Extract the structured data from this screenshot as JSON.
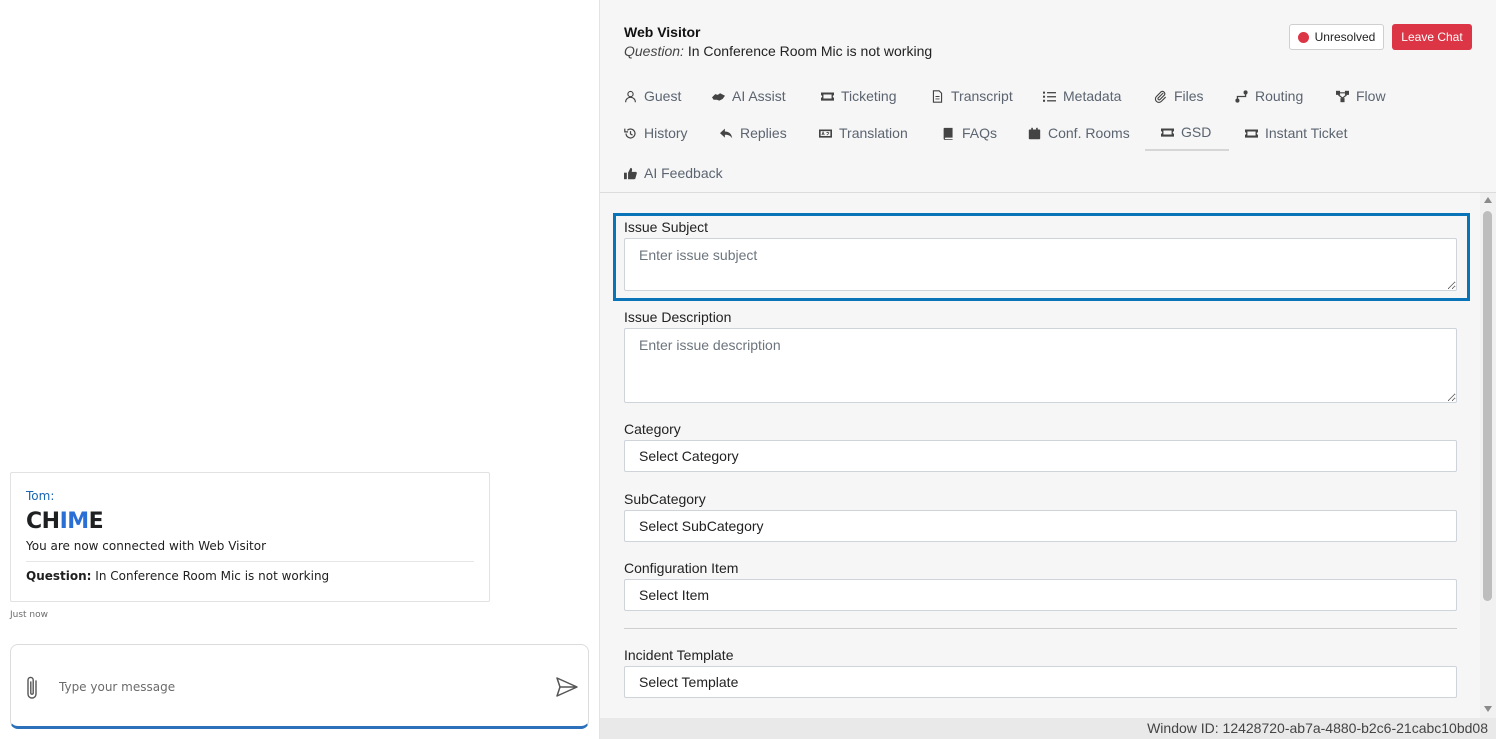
{
  "chat": {
    "sender": "Tom:",
    "logo_text_1": "CH",
    "logo_text_2": "IM",
    "logo_text_3": "E",
    "connected_message": "You are now connected with Web Visitor",
    "question_label": "Question:",
    "question_text": " In Conference Room Mic is not working",
    "timestamp": "Just now",
    "composer_placeholder": "Type your message"
  },
  "header": {
    "visitor_name": "Web Visitor",
    "question_label": "Question:",
    "question_text": " In Conference Room Mic is not working",
    "status_label": "Unresolved",
    "status_color": "#dc3545",
    "leave_chat_label": "Leave Chat"
  },
  "tabs": [
    {
      "label": "Guest",
      "icon": "user-icon"
    },
    {
      "label": "AI Assist",
      "icon": "handshake-icon"
    },
    {
      "label": "Ticketing",
      "icon": "ticket-icon"
    },
    {
      "label": "Transcript",
      "icon": "document-icon"
    },
    {
      "label": "Metadata",
      "icon": "list-icon"
    },
    {
      "label": "Files",
      "icon": "paperclip-icon"
    },
    {
      "label": "Routing",
      "icon": "routing-icon"
    },
    {
      "label": "Flow",
      "icon": "flow-icon"
    },
    {
      "label": "History",
      "icon": "history-icon"
    },
    {
      "label": "Replies",
      "icon": "reply-icon"
    },
    {
      "label": "Translation",
      "icon": "translation-icon"
    },
    {
      "label": "FAQs",
      "icon": "book-icon"
    },
    {
      "label": "Conf. Rooms",
      "icon": "calendar-icon"
    },
    {
      "label": "GSD",
      "icon": "ticket-icon",
      "active": true
    },
    {
      "label": "Instant Ticket",
      "icon": "ticket-icon"
    },
    {
      "label": "AI Feedback",
      "icon": "thumbs-up-icon"
    }
  ],
  "form": {
    "subject_label": "Issue Subject",
    "subject_placeholder": "Enter issue subject",
    "description_label": "Issue Description",
    "description_placeholder": "Enter issue description",
    "category_label": "Category",
    "category_value": "Select Category",
    "subcategory_label": "SubCategory",
    "subcategory_value": "Select SubCategory",
    "config_item_label": "Configuration Item",
    "config_item_value": "Select Item",
    "template_label": "Incident Template",
    "template_value": "Select Template"
  },
  "footer": {
    "window_id": "Window ID: 12428720-ab7a-4880-b2c6-21cabc10bd08"
  }
}
